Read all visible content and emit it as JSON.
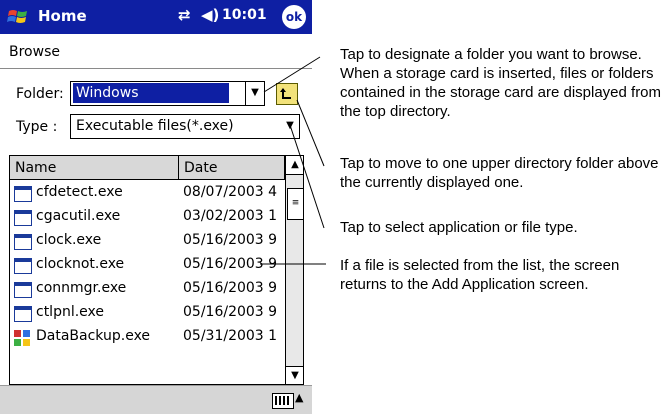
{
  "titlebar": {
    "title": "Home",
    "time": "10:01",
    "ok_label": "ok",
    "background": "#0e1fa3"
  },
  "screen": {
    "section_label": "Browse",
    "folder": {
      "label": "Folder:",
      "value": "Windows"
    },
    "type": {
      "label": "Type :",
      "value": "Executable files(*.exe)"
    }
  },
  "file_list": {
    "columns": [
      "Name",
      "Date"
    ],
    "rows": [
      {
        "name": "cfdetect.exe",
        "date": "08/07/2003 4",
        "icon": "exe-file-icon"
      },
      {
        "name": "cgacutil.exe",
        "date": "03/02/2003 1",
        "icon": "exe-file-icon"
      },
      {
        "name": "clock.exe",
        "date": "05/16/2003 9",
        "icon": "exe-file-icon"
      },
      {
        "name": "clocknot.exe",
        "date": "05/16/2003 9",
        "icon": "exe-file-icon"
      },
      {
        "name": "connmgr.exe",
        "date": "05/16/2003 9",
        "icon": "exe-file-icon"
      },
      {
        "name": "ctlpnl.exe",
        "date": "05/16/2003 9",
        "icon": "exe-file-icon"
      },
      {
        "name": "DataBackup.exe",
        "date": "05/31/2003 1",
        "icon": "databackup-app-icon"
      }
    ]
  },
  "annotations": {
    "folder": "Tap to designate a folder you want to browse. When a storage card is inserted, files or folders contained in the storage card are displayed from the top directory.",
    "up": "Tap to move to one upper directory folder above the currently displayed one.",
    "type": "Tap to select application or file type.",
    "select": "If a file is selected from the list, the screen returns to the Add Application screen."
  }
}
